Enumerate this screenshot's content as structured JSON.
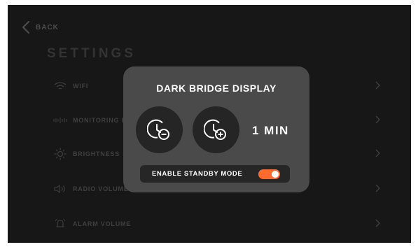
{
  "header": {
    "back_label": "BACK"
  },
  "settings": {
    "title": "SETTINGS",
    "items": [
      {
        "label": "WIFI",
        "icon": "wifi-icon"
      },
      {
        "label": "MONITORING FR",
        "icon": "monitoring-frequency-icon"
      },
      {
        "label": "BRIGHTNESS",
        "icon": "brightness-icon"
      },
      {
        "label": "RADIO VOLUME",
        "icon": "speaker-icon"
      },
      {
        "label": "ALARM VOLUME",
        "icon": "alarm-icon"
      }
    ]
  },
  "modal": {
    "title": "DARK BRIDGE DISPLAY",
    "decrease_icon": "clock-minus-icon",
    "increase_icon": "clock-plus-icon",
    "timer_value": "1 MIN",
    "standby_label": "ENABLE STANDBY MODE",
    "standby_enabled": true
  },
  "colors": {
    "accent": "#ff6a2e",
    "screen_bg": "#1c1c1c",
    "modal_bg": "#4a4a4a"
  }
}
